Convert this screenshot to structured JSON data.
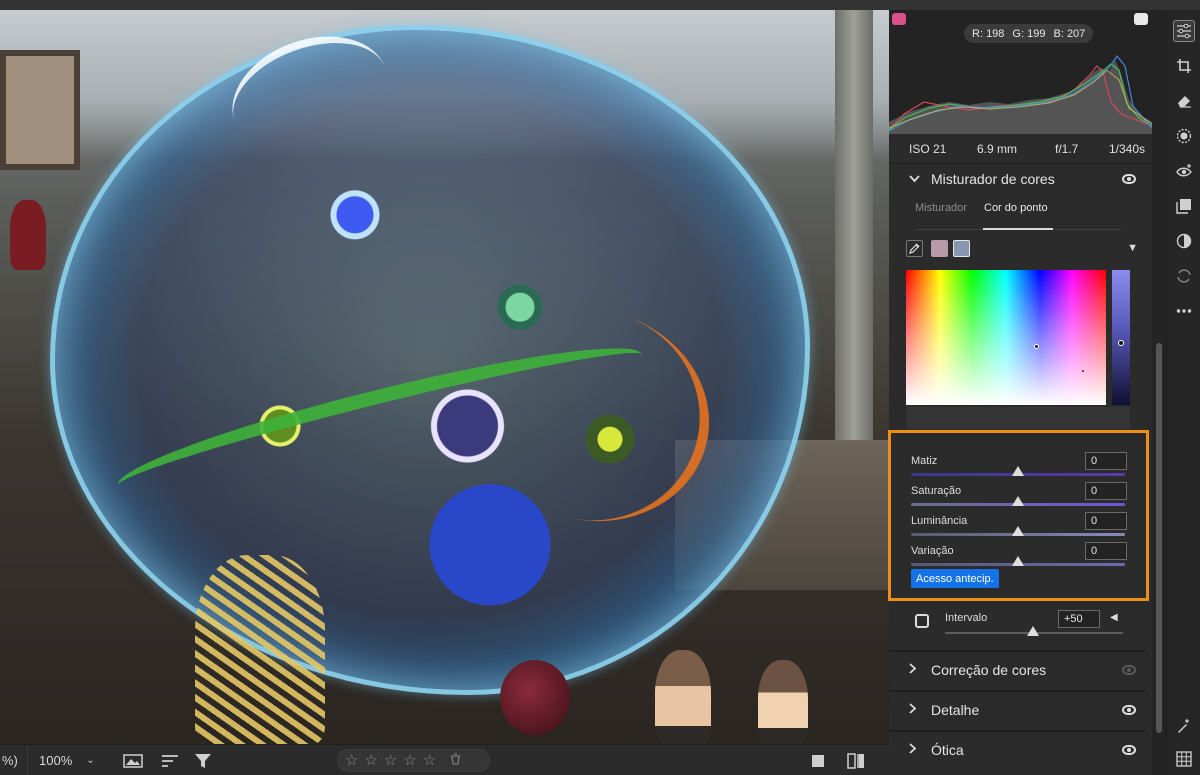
{
  "histogram": {
    "rgb": {
      "r_label": "R:",
      "r": "198",
      "g_label": "G:",
      "g": "199",
      "b_label": "B:",
      "b": "207"
    }
  },
  "exif": {
    "iso": "ISO 21",
    "focal": "6.9 mm",
    "aperture": "f/1.7",
    "shutter": "1/340s"
  },
  "color_mixer": {
    "title": "Misturador de cores",
    "tabs": [
      {
        "label": "Misturador"
      },
      {
        "label": "Cor do ponto"
      }
    ],
    "active_tab": 1,
    "swatch_colors": {
      "sampled": "#b99aa8",
      "selected": "#8797b0"
    },
    "sliders": [
      {
        "label": "Matiz",
        "value": "0"
      },
      {
        "label": "Saturação",
        "value": "0"
      },
      {
        "label": "Luminância",
        "value": "0"
      },
      {
        "label": "Variação",
        "value": "0"
      }
    ],
    "early_access_label": "Acesso antecip.",
    "highlight_color": "#ee8f1b"
  },
  "range": {
    "label": "Intervalo",
    "value": "+50"
  },
  "sections": [
    {
      "title": "Correção de cores",
      "visible": false
    },
    {
      "title": "Detalhe",
      "visible": true
    },
    {
      "title": "Ótica",
      "visible": true
    }
  ],
  "bottom_bar": {
    "zoom_left": "%)",
    "zoom": "100%",
    "rating": {
      "stars": 0,
      "max": 5
    }
  },
  "tools": [
    "edit-sliders-icon",
    "crop-icon",
    "eraser-icon",
    "masking-icon",
    "red-eye-icon",
    "presets-icon",
    "snapshots-icon",
    "versions-icon",
    "more-icon"
  ],
  "accent_color": "#1473e6"
}
